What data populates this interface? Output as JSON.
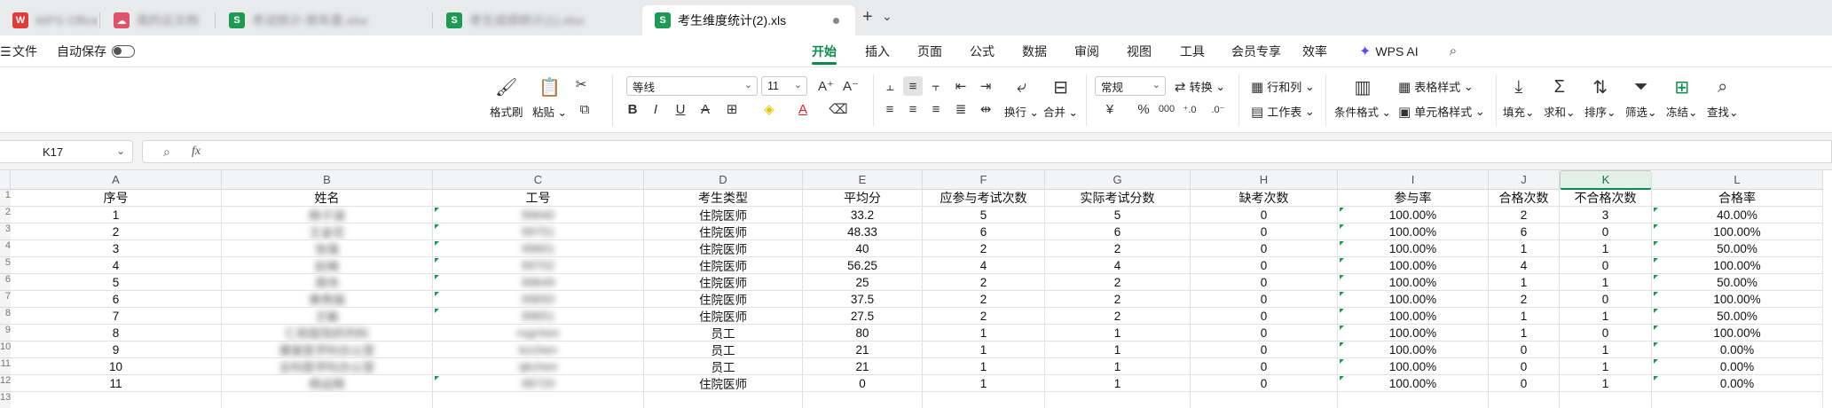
{
  "tabs": {
    "tab1": "WPS Office",
    "tab2": "我的云文档",
    "tab3": "考试统计-按年度.xlsx",
    "tab4": "考生成绩统计(1).xlsx",
    "active": "考生维度统计(2).xls",
    "active_icon": "S",
    "new_tab": "+",
    "more": "⌄"
  },
  "menu": {
    "file": "文件",
    "autosave": "自动保存",
    "items": [
      "开始",
      "插入",
      "页面",
      "公式",
      "数据",
      "审阅",
      "视图",
      "工具",
      "会员专享",
      "效率",
      "WPS AI"
    ]
  },
  "ribbon": {
    "format_painter": "格式刷",
    "paste": "粘贴",
    "font_name": "等线",
    "font_size": "11",
    "number_format": "常规",
    "convert": "转换",
    "rows_cols": "行和列",
    "worksheet": "工作表",
    "table_style": "表格样式",
    "cell_style": "单元格样式",
    "cond_format": "条件格式",
    "wrap": "换行",
    "merge": "合并",
    "fill": "填充",
    "sum": "求和",
    "sort": "排序",
    "filter": "筛选",
    "freeze": "冻结",
    "find": "查找"
  },
  "formula_bar": {
    "name_box": "K17",
    "fx": "fx",
    "value": ""
  },
  "grid": {
    "columns": [
      "A",
      "B",
      "C",
      "D",
      "E",
      "F",
      "G",
      "H",
      "I",
      "J",
      "K",
      "L"
    ],
    "selected_column": "K",
    "row_numbers": [
      "1",
      "2",
      "3",
      "4",
      "5",
      "6",
      "7",
      "8",
      "9",
      "10",
      "11",
      "12",
      "13"
    ],
    "headers": [
      "序号",
      "姓名",
      "工号",
      "考生类型",
      "平均分",
      "应参与考试次数",
      "实际考试分数",
      "缺考次数",
      "参与率",
      "合格次数",
      "不合格次数",
      "合格率"
    ],
    "rows": [
      [
        "1",
        "韩子涵",
        "99640",
        "住院医师",
        "33.2",
        "5",
        "5",
        "0",
        "100.00%",
        "2",
        "3",
        "40.00%"
      ],
      [
        "2",
        "王金花",
        "99751",
        "住院医师",
        "48.33",
        "6",
        "6",
        "0",
        "100.00%",
        "6",
        "0",
        "100.00%"
      ],
      [
        "3",
        "张强",
        "99801",
        "住院医师",
        "40",
        "2",
        "2",
        "0",
        "100.00%",
        "1",
        "1",
        "50.00%"
      ],
      [
        "4",
        "赵梅",
        "99702",
        "住院医师",
        "56.25",
        "4",
        "4",
        "0",
        "100.00%",
        "4",
        "0",
        "100.00%"
      ],
      [
        "5",
        "周伟",
        "99649",
        "住院医师",
        "25",
        "2",
        "2",
        "0",
        "100.00%",
        "1",
        "1",
        "50.00%"
      ],
      [
        "6",
        "黄秀娟",
        "99650",
        "住院医师",
        "37.5",
        "2",
        "2",
        "0",
        "100.00%",
        "2",
        "0",
        "100.00%"
      ],
      [
        "7",
        "王敏",
        "99651",
        "住院医师",
        "27.5",
        "2",
        "2",
        "0",
        "100.00%",
        "1",
        "1",
        "50.00%"
      ],
      [
        "8",
        "仁和医院药剂科",
        "rxgchen",
        "员工",
        "80",
        "1",
        "1",
        "0",
        "100.00%",
        "1",
        "0",
        "100.00%"
      ],
      [
        "9",
        "康复医学科办公室",
        "kzchen",
        "员工",
        "21",
        "1",
        "1",
        "0",
        "100.00%",
        "0",
        "1",
        "0.00%"
      ],
      [
        "10",
        "全科医学科办公室",
        "qkchen",
        "员工",
        "21",
        "1",
        "1",
        "0",
        "100.00%",
        "0",
        "1",
        "0.00%"
      ],
      [
        "11",
        "杨运辉",
        "98720",
        "住院医师",
        "0",
        "1",
        "1",
        "0",
        "100.00%",
        "0",
        "1",
        "0.00%"
      ]
    ]
  },
  "colors": {
    "accent": "#0c8a4a",
    "tabbar": "#e9eaec",
    "header_bg": "#f3f4f6"
  }
}
